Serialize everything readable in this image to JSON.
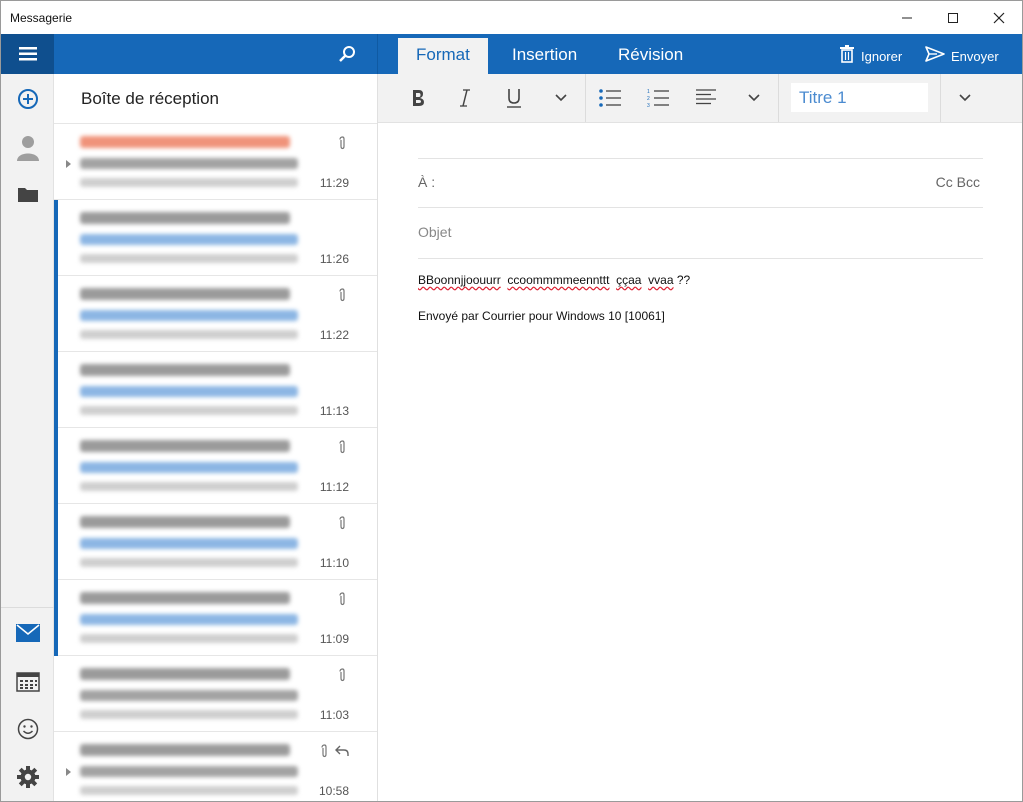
{
  "window": {
    "title": "Messagerie"
  },
  "ribbon": {
    "tabs": [
      {
        "label": "Format",
        "active": true
      },
      {
        "label": "Insertion",
        "active": false
      },
      {
        "label": "Révision",
        "active": false
      }
    ],
    "discard_label": "Ignorer",
    "send_label": "Envoyer"
  },
  "inbox": {
    "title": "Boîte de réception",
    "messages": [
      {
        "time": "11:29",
        "unread": false,
        "attachment": true
      },
      {
        "time": "11:26",
        "unread": true,
        "attachment": false
      },
      {
        "time": "11:22",
        "unread": true,
        "attachment": true
      },
      {
        "time": "11:13",
        "unread": true,
        "attachment": false
      },
      {
        "time": "11:12",
        "unread": true,
        "attachment": true
      },
      {
        "time": "11:10",
        "unread": true,
        "attachment": true
      },
      {
        "time": "11:09",
        "unread": true,
        "attachment": true
      },
      {
        "time": "11:03",
        "unread": false,
        "attachment": true
      },
      {
        "time": "10:58",
        "unread": false,
        "attachment": true,
        "replied": true
      }
    ]
  },
  "format_toolbar": {
    "style_value": "Titre 1"
  },
  "compose": {
    "to_label": "À :",
    "cc_bcc_label": "Cc Bcc",
    "subject_placeholder": "Objet",
    "body": {
      "word1": "BBoonnjjoouurr",
      "word2": "ccoommmmeennttt",
      "word3": "ççaa",
      "word4": "vvaa",
      "punct": "??"
    },
    "signature": "Envoyé par Courrier pour Windows 10 [10061]"
  },
  "colors": {
    "accent": "#1668b8",
    "accent_dark": "#0f4f8e",
    "rail_bg": "#f2f2f2"
  },
  "icons": [
    "hamburger-icon",
    "search-icon",
    "trash-icon",
    "send-icon",
    "new-mail-icon",
    "people-icon",
    "folder-icon",
    "mail-icon",
    "calendar-icon",
    "smiley-icon",
    "settings-icon",
    "paperclip-icon",
    "reply-icon"
  ]
}
